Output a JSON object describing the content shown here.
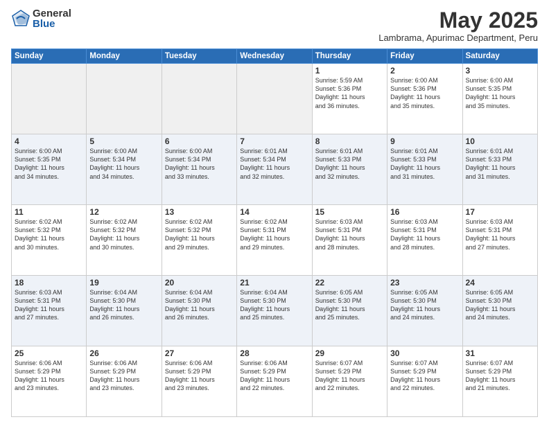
{
  "logo": {
    "general": "General",
    "blue": "Blue"
  },
  "title": {
    "month_year": "May 2025",
    "location": "Lambrama, Apurimac Department, Peru"
  },
  "days_of_week": [
    "Sunday",
    "Monday",
    "Tuesday",
    "Wednesday",
    "Thursday",
    "Friday",
    "Saturday"
  ],
  "weeks": [
    {
      "row_class": "row-1",
      "days": [
        {
          "num": "",
          "info": "",
          "empty": true
        },
        {
          "num": "",
          "info": "",
          "empty": true
        },
        {
          "num": "",
          "info": "",
          "empty": true
        },
        {
          "num": "",
          "info": "",
          "empty": true
        },
        {
          "num": "1",
          "info": "Sunrise: 5:59 AM\nSunset: 5:36 PM\nDaylight: 11 hours\nand 36 minutes."
        },
        {
          "num": "2",
          "info": "Sunrise: 6:00 AM\nSunset: 5:36 PM\nDaylight: 11 hours\nand 35 minutes."
        },
        {
          "num": "3",
          "info": "Sunrise: 6:00 AM\nSunset: 5:35 PM\nDaylight: 11 hours\nand 35 minutes."
        }
      ]
    },
    {
      "row_class": "row-2",
      "days": [
        {
          "num": "4",
          "info": "Sunrise: 6:00 AM\nSunset: 5:35 PM\nDaylight: 11 hours\nand 34 minutes."
        },
        {
          "num": "5",
          "info": "Sunrise: 6:00 AM\nSunset: 5:34 PM\nDaylight: 11 hours\nand 34 minutes."
        },
        {
          "num": "6",
          "info": "Sunrise: 6:00 AM\nSunset: 5:34 PM\nDaylight: 11 hours\nand 33 minutes."
        },
        {
          "num": "7",
          "info": "Sunrise: 6:01 AM\nSunset: 5:34 PM\nDaylight: 11 hours\nand 32 minutes."
        },
        {
          "num": "8",
          "info": "Sunrise: 6:01 AM\nSunset: 5:33 PM\nDaylight: 11 hours\nand 32 minutes."
        },
        {
          "num": "9",
          "info": "Sunrise: 6:01 AM\nSunset: 5:33 PM\nDaylight: 11 hours\nand 31 minutes."
        },
        {
          "num": "10",
          "info": "Sunrise: 6:01 AM\nSunset: 5:33 PM\nDaylight: 11 hours\nand 31 minutes."
        }
      ]
    },
    {
      "row_class": "row-3",
      "days": [
        {
          "num": "11",
          "info": "Sunrise: 6:02 AM\nSunset: 5:32 PM\nDaylight: 11 hours\nand 30 minutes."
        },
        {
          "num": "12",
          "info": "Sunrise: 6:02 AM\nSunset: 5:32 PM\nDaylight: 11 hours\nand 30 minutes."
        },
        {
          "num": "13",
          "info": "Sunrise: 6:02 AM\nSunset: 5:32 PM\nDaylight: 11 hours\nand 29 minutes."
        },
        {
          "num": "14",
          "info": "Sunrise: 6:02 AM\nSunset: 5:31 PM\nDaylight: 11 hours\nand 29 minutes."
        },
        {
          "num": "15",
          "info": "Sunrise: 6:03 AM\nSunset: 5:31 PM\nDaylight: 11 hours\nand 28 minutes."
        },
        {
          "num": "16",
          "info": "Sunrise: 6:03 AM\nSunset: 5:31 PM\nDaylight: 11 hours\nand 28 minutes."
        },
        {
          "num": "17",
          "info": "Sunrise: 6:03 AM\nSunset: 5:31 PM\nDaylight: 11 hours\nand 27 minutes."
        }
      ]
    },
    {
      "row_class": "row-4",
      "days": [
        {
          "num": "18",
          "info": "Sunrise: 6:03 AM\nSunset: 5:31 PM\nDaylight: 11 hours\nand 27 minutes."
        },
        {
          "num": "19",
          "info": "Sunrise: 6:04 AM\nSunset: 5:30 PM\nDaylight: 11 hours\nand 26 minutes."
        },
        {
          "num": "20",
          "info": "Sunrise: 6:04 AM\nSunset: 5:30 PM\nDaylight: 11 hours\nand 26 minutes."
        },
        {
          "num": "21",
          "info": "Sunrise: 6:04 AM\nSunset: 5:30 PM\nDaylight: 11 hours\nand 25 minutes."
        },
        {
          "num": "22",
          "info": "Sunrise: 6:05 AM\nSunset: 5:30 PM\nDaylight: 11 hours\nand 25 minutes."
        },
        {
          "num": "23",
          "info": "Sunrise: 6:05 AM\nSunset: 5:30 PM\nDaylight: 11 hours\nand 24 minutes."
        },
        {
          "num": "24",
          "info": "Sunrise: 6:05 AM\nSunset: 5:30 PM\nDaylight: 11 hours\nand 24 minutes."
        }
      ]
    },
    {
      "row_class": "row-5",
      "days": [
        {
          "num": "25",
          "info": "Sunrise: 6:06 AM\nSunset: 5:29 PM\nDaylight: 11 hours\nand 23 minutes."
        },
        {
          "num": "26",
          "info": "Sunrise: 6:06 AM\nSunset: 5:29 PM\nDaylight: 11 hours\nand 23 minutes."
        },
        {
          "num": "27",
          "info": "Sunrise: 6:06 AM\nSunset: 5:29 PM\nDaylight: 11 hours\nand 23 minutes."
        },
        {
          "num": "28",
          "info": "Sunrise: 6:06 AM\nSunset: 5:29 PM\nDaylight: 11 hours\nand 22 minutes."
        },
        {
          "num": "29",
          "info": "Sunrise: 6:07 AM\nSunset: 5:29 PM\nDaylight: 11 hours\nand 22 minutes."
        },
        {
          "num": "30",
          "info": "Sunrise: 6:07 AM\nSunset: 5:29 PM\nDaylight: 11 hours\nand 22 minutes."
        },
        {
          "num": "31",
          "info": "Sunrise: 6:07 AM\nSunset: 5:29 PM\nDaylight: 11 hours\nand 21 minutes."
        }
      ]
    }
  ]
}
